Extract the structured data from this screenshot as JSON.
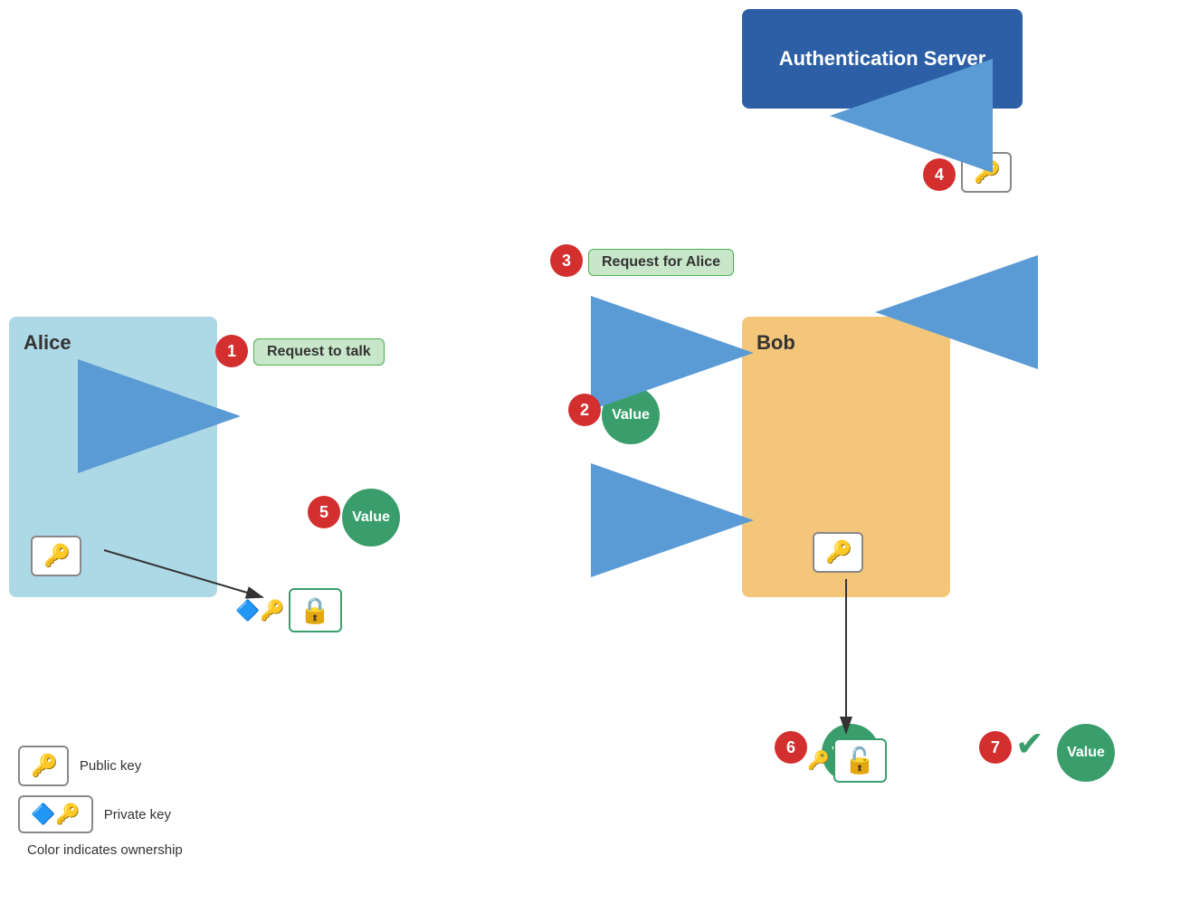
{
  "authServer": {
    "label": "Authentication Server"
  },
  "alice": {
    "label": "Alice"
  },
  "bob": {
    "label": "Bob"
  },
  "steps": [
    {
      "number": "1",
      "label": "step1-badge"
    },
    {
      "number": "2",
      "label": "step2-badge"
    },
    {
      "number": "3",
      "label": "step3-badge"
    },
    {
      "number": "4",
      "label": "step4-badge"
    },
    {
      "number": "5",
      "label": "step5-badge"
    },
    {
      "number": "6",
      "label": "step6-badge"
    },
    {
      "number": "7",
      "label": "step7-badge"
    }
  ],
  "messages": {
    "requestToTalk": "Request to talk",
    "requestForAlice": "Request for Alice"
  },
  "values": {
    "label": "Value"
  },
  "legend": {
    "publicKey": "Public key",
    "privateKey": "Private key",
    "colorNote": "Color indicates ownership"
  }
}
